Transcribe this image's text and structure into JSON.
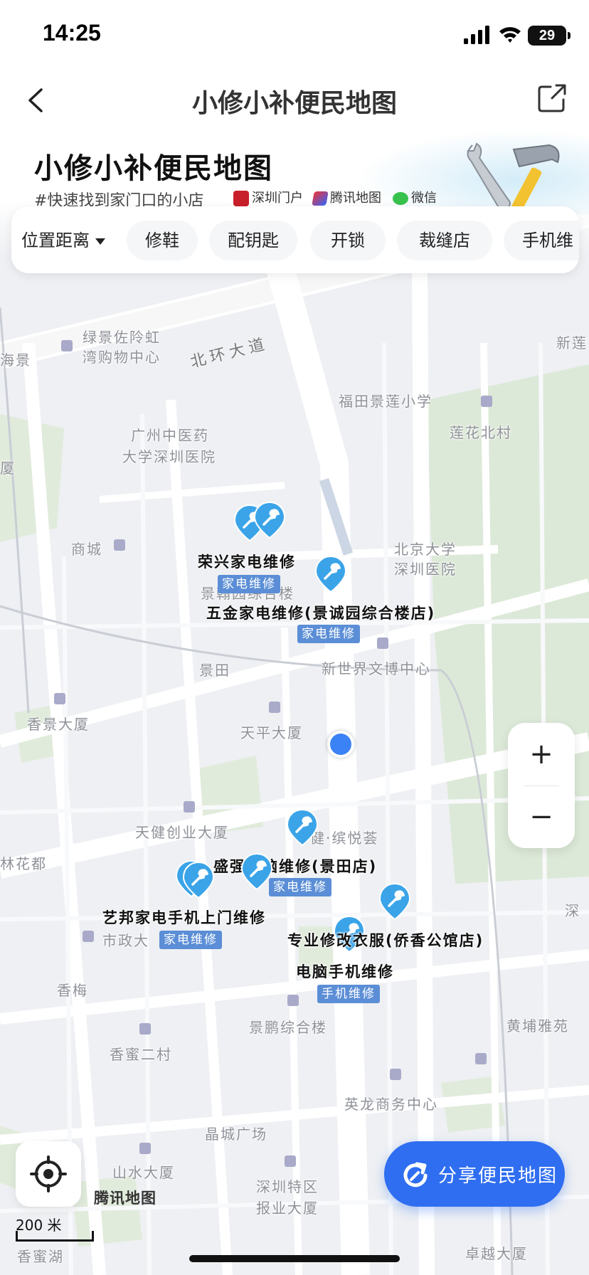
{
  "status_bar": {
    "time": "14:25",
    "battery": "29"
  },
  "nav": {
    "title": "小修小补便民地图"
  },
  "banner": {
    "title": "小修小补便民地图",
    "subtitle": "#快速找到家门口的小店",
    "brands": [
      "深圳门户",
      "腾讯地图",
      "微信"
    ]
  },
  "filters": [
    "位置距离",
    "修鞋",
    "配钥匙",
    "开锁",
    "裁缝店",
    "手机维"
  ],
  "map_labels": [
    "绿景佐阾虹",
    "湾购物中心",
    "福田景莲小学",
    "莲花北村",
    "广州中医药",
    "大学深圳医院",
    "商城",
    "北京大学",
    "深圳医院",
    "景田",
    "新世界文博中心",
    "香景大厦",
    "天平大厦",
    "天健创业大厦",
    "健·缤悦荟",
    "香梅",
    "市政大",
    "景鹏综合楼",
    "黄埔雅苑",
    "香蜜二村",
    "英龙商务中心",
    "晶城广场",
    "山水大厦",
    "深圳特区",
    "报业大厦",
    "卓越大厦",
    "香蜜湖",
    "新莲",
    "海景",
    "厦",
    "深",
    "林花都",
    "景翰园综合楼"
  ],
  "road_label": "北环大道",
  "shops": [
    {
      "name": "荣兴家电维修",
      "tag": "家电维修"
    },
    {
      "name": "五金家电维修(景诚园综合楼店)",
      "tag": "家电维修"
    },
    {
      "name": "盛强电脑维修(景田店)",
      "tag": "家电维修"
    },
    {
      "name": "艺邦家电手机上门维修",
      "tag": "家电维修"
    },
    {
      "name": "专业修改衣服(侨香公馆店)",
      "tag": ""
    },
    {
      "name": "电脑手机维修",
      "tag": "手机维修"
    }
  ],
  "zoom": {
    "in": "+",
    "out": "−"
  },
  "map_provider": "腾讯地图",
  "scale": "200 米",
  "share_button": "分享便民地图",
  "colors": {
    "accent": "#2f6ef0",
    "marker": "#3ba4e8",
    "tag": "#5b8ed6"
  }
}
